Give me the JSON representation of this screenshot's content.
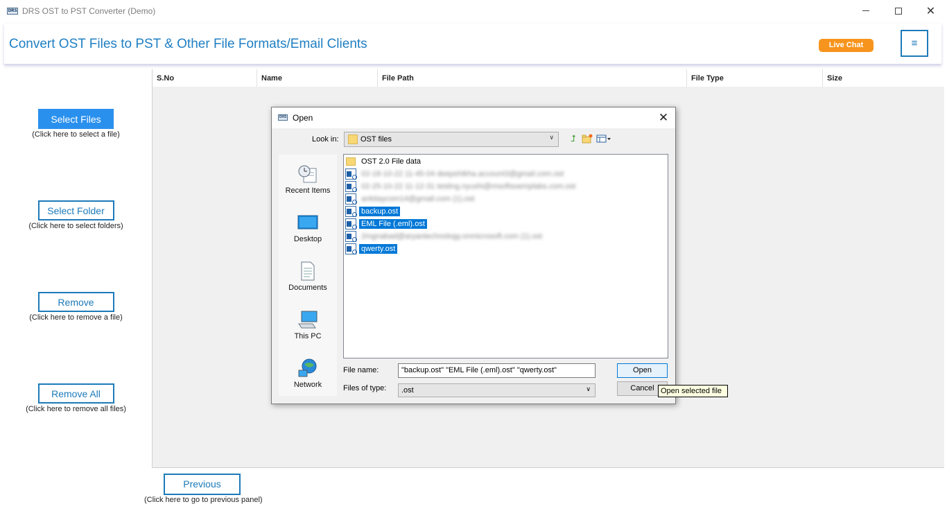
{
  "window": {
    "title": "DRS OST to PST Converter (Demo)",
    "logo_text": "DRS"
  },
  "header": {
    "title": "Convert OST Files to PST & Other File Formats/Email Clients",
    "live_chat": "Live Chat",
    "menu_glyph": "≡"
  },
  "left_panel": {
    "select_files": {
      "label": "Select Files",
      "hint": "(Click here to select a file)"
    },
    "select_folder": {
      "label": "Select Folder",
      "hint": "(Click here to select folders)"
    },
    "remove": {
      "label": "Remove",
      "hint": "(Click here to remove a file)"
    },
    "remove_all": {
      "label": "Remove All",
      "hint": "(Click here to remove all files)"
    }
  },
  "table": {
    "columns": [
      "S.No",
      "Name",
      "File Path",
      "File Type",
      "Size"
    ]
  },
  "footer": {
    "previous": {
      "label": "Previous",
      "hint": "(Click here to go to previous panel)"
    }
  },
  "dialog": {
    "title": "Open",
    "logo_text": "DRS",
    "look_in_label": "Look in:",
    "look_in_value": "OST files",
    "places": [
      "Recent Items",
      "Desktop",
      "Documents",
      "This PC",
      "Network"
    ],
    "files": [
      {
        "name": "OST 2.0 File data",
        "type": "folder",
        "selected": false,
        "obscured": false
      },
      {
        "name": "02-18-10-22 11-45-04 deepshikha.account3@gmail.com.ost",
        "type": "ost",
        "selected": false,
        "obscured": true
      },
      {
        "name": "02-25-10-22 11-12-31 testing.nyushi@msoftsoemplabs.com.ost",
        "type": "ost",
        "selected": false,
        "obscured": true
      },
      {
        "name": "ankitaycom14@gmail.com (1).ost",
        "type": "ost",
        "selected": false,
        "obscured": true
      },
      {
        "name": "backup.ost",
        "type": "ost",
        "selected": true,
        "obscured": false
      },
      {
        "name": "EML File (.eml).ost",
        "type": "ost",
        "selected": true,
        "obscured": false
      },
      {
        "name": "2mgnabad@aryantechnology.onmicrosoft.com (1).ost",
        "type": "ost",
        "selected": false,
        "obscured": true
      },
      {
        "name": "qwerty.ost",
        "type": "ost",
        "selected": true,
        "obscured": false
      }
    ],
    "file_name_label": "File name:",
    "file_name_value": "\"backup.ost\" \"EML File (.eml).ost\" \"qwerty.ost\"",
    "file_type_label": "Files of type:",
    "file_type_value": ".ost",
    "open_button": "Open",
    "cancel_button": "Cancel",
    "tooltip": "Open selected file"
  },
  "colors": {
    "accent": "#1c7ab9",
    "primary_button": "#2a90ee",
    "live_chat": "#f7941d",
    "selection": "#0078d7"
  }
}
